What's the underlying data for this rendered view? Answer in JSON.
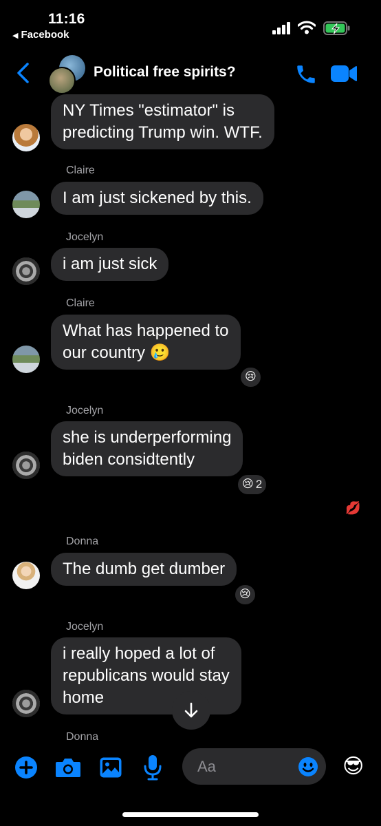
{
  "status_bar": {
    "time": "11:16",
    "back_app": "Facebook",
    "back_glyph": "◀"
  },
  "header": {
    "title": "Political free spirits?",
    "back_icon": "chevron-left-icon",
    "call_icon": "phone-icon",
    "video_icon": "video-camera-icon",
    "accent_color": "#0a84ff"
  },
  "messages": [
    {
      "sender": "",
      "text": "NY Times \"estimator\" is\npredicting Trump win. WTF.",
      "reaction": "",
      "reaction_count": ""
    },
    {
      "sender": "Claire",
      "text": "I am just sickened by this.",
      "reaction": "",
      "reaction_count": ""
    },
    {
      "sender": "Jocelyn",
      "text": "i am just sick",
      "reaction": "",
      "reaction_count": ""
    },
    {
      "sender": "Claire",
      "text": "What has happened to\nour country 🥲",
      "reaction": "😢",
      "reaction_count": ""
    },
    {
      "sender": "Jocelyn",
      "text": "she is underperforming\nbiden considtently",
      "reaction": "😢",
      "reaction_count": "2"
    },
    {
      "sender": "Donna",
      "text": "The dumb get dumber",
      "reaction": "😢",
      "reaction_count": ""
    },
    {
      "sender": "Jocelyn",
      "text": "i really hoped a lot of\nrepublicans would stay\nhome",
      "reaction": "",
      "reaction_count": ""
    }
  ],
  "next_sender_partial": "Donna",
  "seen_marker": "💋",
  "composer": {
    "placeholder": "Aa",
    "plus_icon": "plus-circle-icon",
    "camera_icon": "camera-icon",
    "gallery_icon": "image-icon",
    "mic_icon": "microphone-icon",
    "emoji_icon": "smiley-icon",
    "quick_emoji": "😎"
  }
}
